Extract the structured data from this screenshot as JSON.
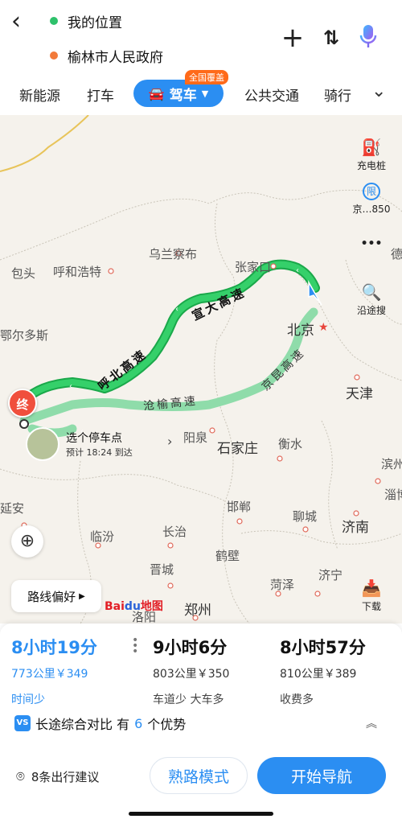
{
  "header": {
    "back_icon": "back-arrow-icon",
    "start": "我的位置",
    "end": "榆林市人民政府",
    "add_icon": "plus-icon",
    "swap_icon": "swap-icon",
    "mic_icon": "microphone-icon"
  },
  "tabs": {
    "items": [
      "新能源",
      "打车",
      "驾车",
      "公共交通",
      "骑行"
    ],
    "active": "驾车",
    "badge": "全国覆盖",
    "more_icon": "chevron-down-icon"
  },
  "map": {
    "cities": [
      "包头",
      "呼和浩特",
      "乌兰察布",
      "张家口",
      "北京",
      "鄂尔多斯",
      "天津",
      "阳泉",
      "石家庄",
      "衡水",
      "延安",
      "临汾",
      "长治",
      "邯郸",
      "聊城",
      "济南",
      "晋城",
      "鹤壁",
      "菏泽",
      "济宁",
      "郑州",
      "洛阳",
      "滨州",
      "淄博",
      "德"
    ],
    "roads": [
      "宣大高速",
      "呼北高速",
      "沧榆高速",
      "京昆高速"
    ],
    "tools": {
      "charging": "充电桩",
      "restriction": "京…850",
      "restriction_char": "限",
      "more": "•••",
      "search_along": "沿途搜",
      "download": "下载"
    },
    "end_marker": "终",
    "parking": {
      "title": "选个停车点",
      "eta": "预计 18:24 到达"
    },
    "route_pref": "路线偏好",
    "logo": {
      "a": "Bai",
      "b": "du",
      "c": "地图"
    }
  },
  "routes": [
    {
      "time": "8小时19分",
      "info": "773公里￥349",
      "tag": "时间少"
    },
    {
      "time": "9小时6分",
      "info": "803公里￥350",
      "tag": "车道少 大车多"
    },
    {
      "time": "8小时57分",
      "info": "810公里￥389",
      "tag": "收费多"
    }
  ],
  "compare": {
    "prefix": "长途综合对比 有",
    "count": "6",
    "suffix": "个优势",
    "icon": "VS"
  },
  "footer": {
    "suggest": "8条出行建议",
    "familiar": "熟路模式",
    "navigate": "开始导航"
  },
  "colors": {
    "accent": "#2b8ef2",
    "route_main": "#23c25a",
    "route_alt": "#8fdcaa",
    "end": "#f04f3d"
  }
}
